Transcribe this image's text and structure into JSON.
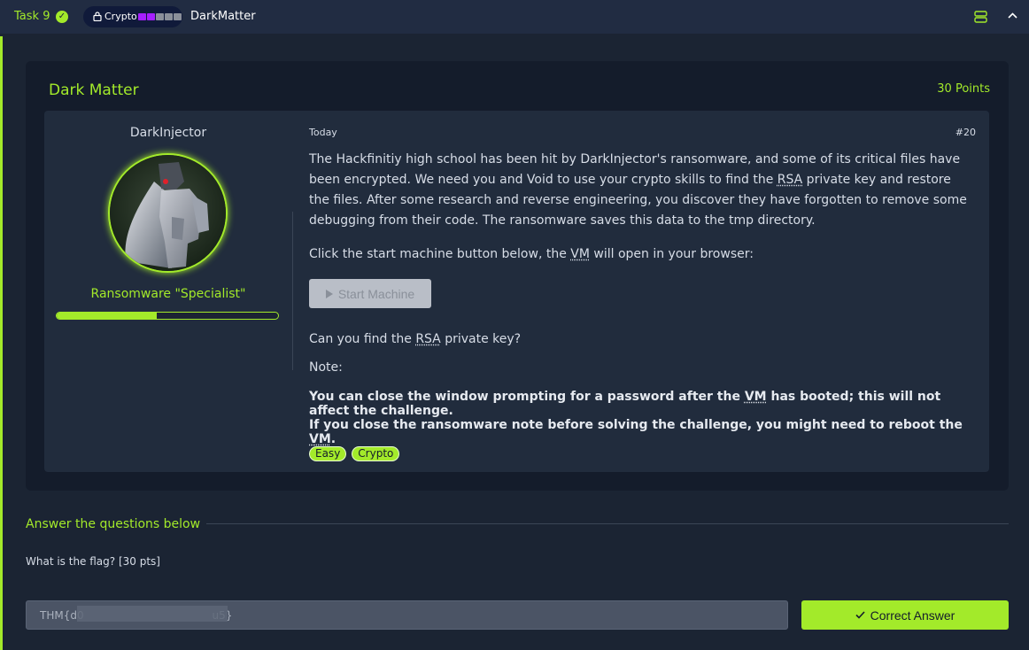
{
  "header": {
    "task_label": "Task 9",
    "pill_label": "Crypto",
    "difficulty_dots": [
      "#a61fff",
      "#a61fff",
      "#8a8f99",
      "#8a8f99",
      "#8a8f99"
    ],
    "room_name": "DarkMatter"
  },
  "task": {
    "title": "Dark Matter",
    "points": "30 Points",
    "author": {
      "name": "DarkInjector",
      "role": "Ransomware \"Specialist\"",
      "rank_progress": 0.45
    },
    "post": {
      "date": "Today",
      "id": "#20",
      "para1_a": "The Hackfinitiy high school has been hit by DarkInjector's ransomware, and some of its critical files have been encrypted. We need you and Void to use your crypto skills to find the ",
      "abbr_rsa": "RSA",
      "para1_b": " private key and restore the files. After some research and reverse engineering, you discover they have forgotten to remove some debugging from their code. The ransomware saves this data to the tmp directory.",
      "para2_a": "Click the start machine button below, the ",
      "abbr_vm": "VM",
      "para2_b": " will open in your browser:",
      "start_button": "Start Machine",
      "question_a": "Can you find the ",
      "question_b": " private key?",
      "note_label": "Note:",
      "bold1_a": "You can close the window prompting for a password after the ",
      "bold1_b": " has booted; this will not affect the challenge.",
      "bold2_a": "If you close the ransomware note before solving the challenge, you might need to reboot the ",
      "bold2_b": ".",
      "tags": [
        "Easy",
        "Crypto"
      ]
    }
  },
  "answers": {
    "heading": "Answer the questions below",
    "question": "What is the flag? [30 pts]",
    "input_value": "THM{d0                                      u5}",
    "submit_label": "Correct Answer"
  },
  "colors": {
    "accent": "#a3ea2a",
    "background": "#1b2433",
    "card": "#141c2b",
    "inner": "#212c3d"
  }
}
